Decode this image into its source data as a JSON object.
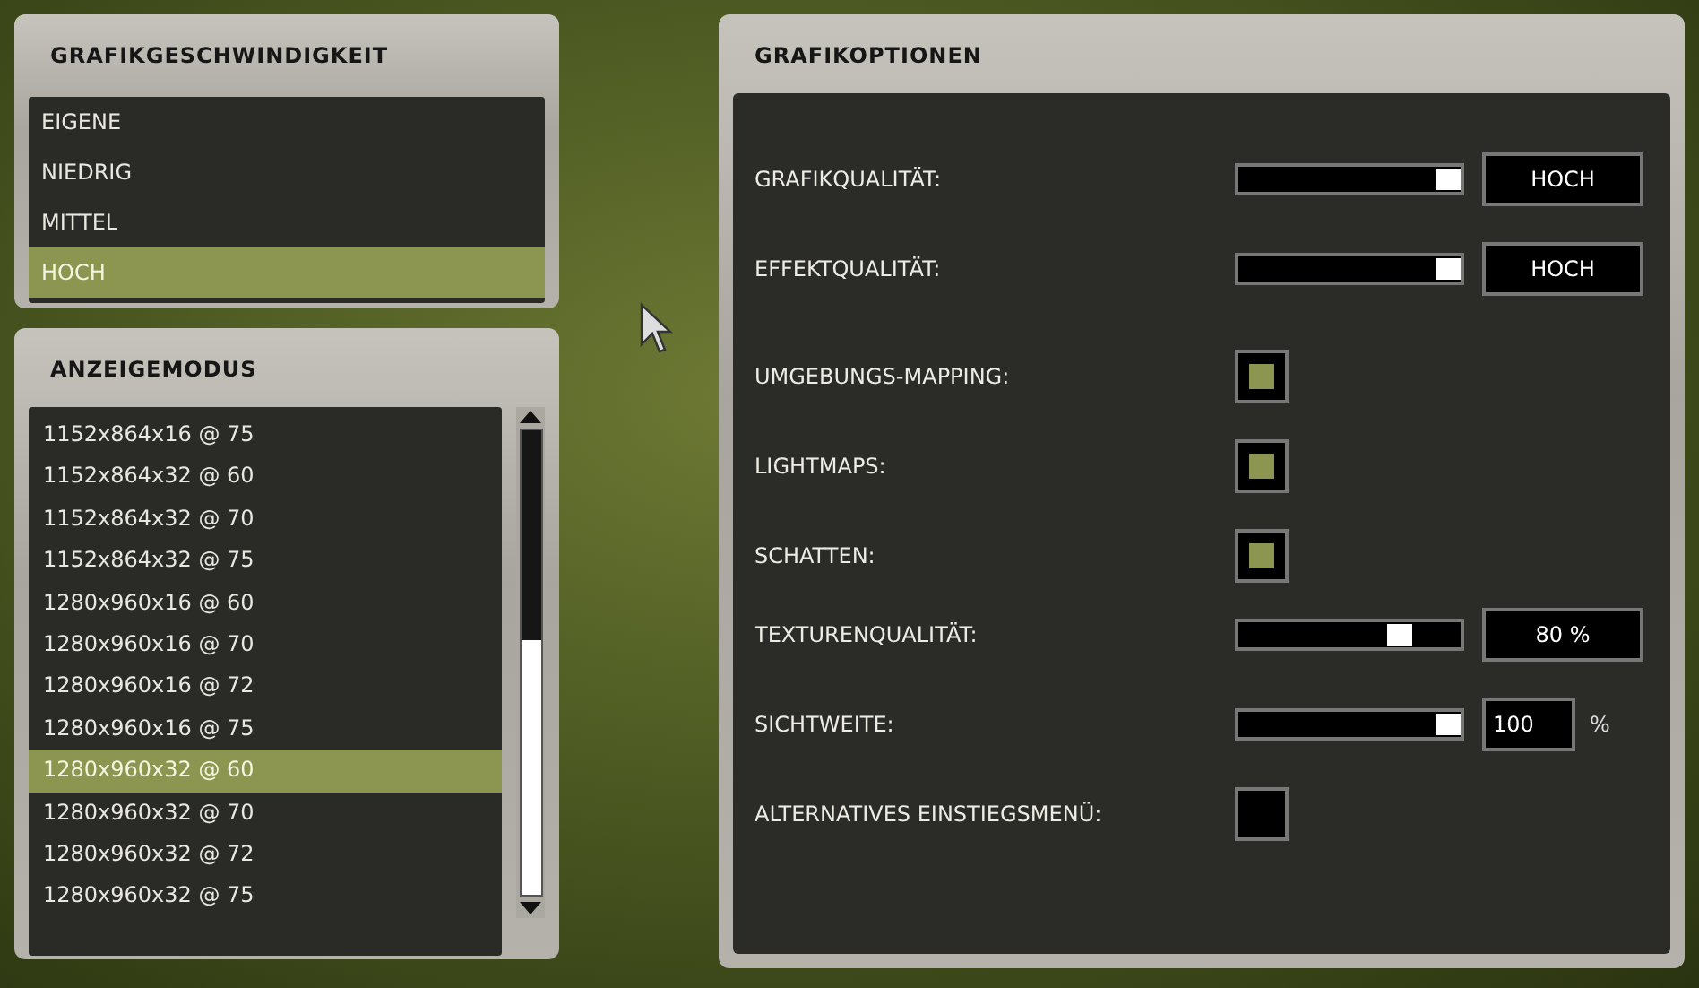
{
  "speed_panel": {
    "title": "GRAFIKGESCHWINDIGKEIT",
    "items": [
      {
        "label": "EIGENE",
        "selected": false
      },
      {
        "label": "NIEDRIG",
        "selected": false
      },
      {
        "label": "MITTEL",
        "selected": false
      },
      {
        "label": "HOCH",
        "selected": true
      }
    ]
  },
  "display_panel": {
    "title": "ANZEIGEMODUS",
    "modes": [
      {
        "label": "1152x864x16 @ 75",
        "selected": false
      },
      {
        "label": "1152x864x32 @ 60",
        "selected": false
      },
      {
        "label": "1152x864x32 @ 70",
        "selected": false
      },
      {
        "label": "1152x864x32 @ 75",
        "selected": false
      },
      {
        "label": "1280x960x16 @ 60",
        "selected": false
      },
      {
        "label": "1280x960x16 @ 70",
        "selected": false
      },
      {
        "label": "1280x960x16 @ 72",
        "selected": false
      },
      {
        "label": "1280x960x16 @ 75",
        "selected": false
      },
      {
        "label": "1280x960x32 @ 60",
        "selected": true
      },
      {
        "label": "1280x960x32 @ 70",
        "selected": false
      },
      {
        "label": "1280x960x32 @ 72",
        "selected": false
      },
      {
        "label": "1280x960x32 @ 75",
        "selected": false
      }
    ]
  },
  "options_panel": {
    "title": "GRAFIKOPTIONEN",
    "options": [
      {
        "kind": "slider",
        "label": "GRAFIKQUALITÄT:",
        "level": 1,
        "value": "HOCH"
      },
      {
        "kind": "slider",
        "label": "EFFEKTQUALITÄT:",
        "level": 1,
        "value": "HOCH"
      },
      {
        "kind": "checkbox",
        "label": "UMGEBUNGS-MAPPING:",
        "checked": true
      },
      {
        "kind": "checkbox",
        "label": "LIGHTMAPS:",
        "checked": true
      },
      {
        "kind": "checkbox",
        "label": "SCHATTEN:",
        "checked": true
      },
      {
        "kind": "slider",
        "label": "TEXTURENQUALITÄT:",
        "level": 0.75,
        "value": "80 %"
      },
      {
        "kind": "slider_unit",
        "label": "SICHTWEITE:",
        "level": 1,
        "value": "100",
        "unit": "%"
      },
      {
        "kind": "checkbox",
        "label": "ALTERNATIVES EINSTIEGSMENÜ:",
        "checked": false
      }
    ]
  }
}
